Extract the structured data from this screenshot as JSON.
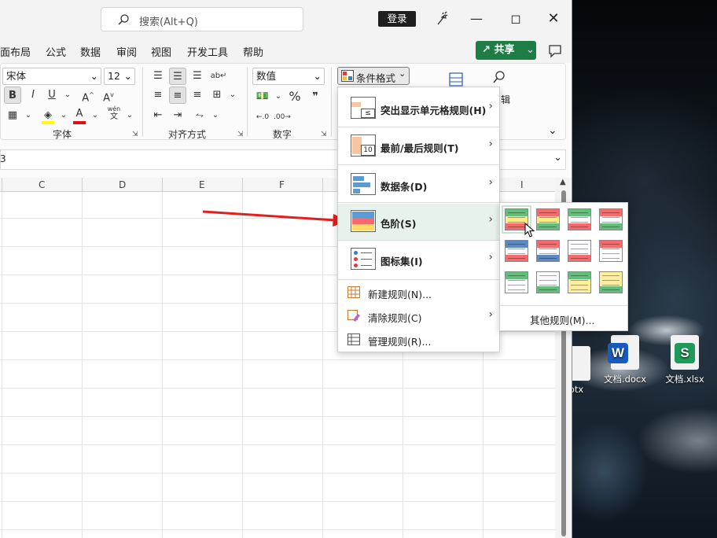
{
  "titlebar": {
    "search_placeholder": "搜索(Alt+Q)",
    "login_label": "登录"
  },
  "menubar": {
    "items": [
      "面布局",
      "公式",
      "数据",
      "审阅",
      "视图",
      "开发工具",
      "帮助"
    ],
    "share_label": "共享"
  },
  "ribbon": {
    "font_name": "宋体",
    "font_size": "12",
    "number_format": "数值",
    "cf_button_label": "条件格式",
    "group_font": "字体",
    "group_align": "对齐方式",
    "group_number": "数字",
    "edit_partial": "辑",
    "bold": "B",
    "italic": "I",
    "underline": "U",
    "font_grow": "A",
    "font_shrink": "A",
    "font_color": "A",
    "percent": "%",
    "comma": "❞",
    "wen": "wén",
    "wen_char": "文"
  },
  "formula": {
    "cell_ref": "3"
  },
  "columns": [
    "C",
    "D",
    "E",
    "F",
    "I"
  ],
  "cf_menu": {
    "items": [
      {
        "label": "突出显示单元格规则(H)",
        "has_sub": true
      },
      {
        "label": "最前/最后规则(T)",
        "has_sub": true
      },
      {
        "label": "数据条(D)",
        "has_sub": true
      },
      {
        "label": "色阶(S)",
        "has_sub": true
      },
      {
        "label": "图标集(I)",
        "has_sub": true
      }
    ],
    "small_items": [
      {
        "label": "新建规则(N)..."
      },
      {
        "label": "清除规则(C)",
        "has_sub": true
      },
      {
        "label": "管理规则(R)..."
      }
    ],
    "icon_10": "10"
  },
  "color_scales": {
    "more_rules": "其他规则(M)...",
    "swatches": [
      [
        "#63be7b",
        "#ffeb84",
        "#f8696b"
      ],
      [
        "#f8696b",
        "#ffeb84",
        "#63be7b"
      ],
      [
        "#63be7b",
        "#fcfcff",
        "#f8696b"
      ],
      [
        "#f8696b",
        "#fcfcff",
        "#63be7b"
      ],
      [
        "#5a8ac6",
        "#fcfcff",
        "#f8696b"
      ],
      [
        "#f8696b",
        "#fcfcff",
        "#5a8ac6"
      ],
      [
        "#fcfcff",
        "#fcfcff",
        "#f8696b"
      ],
      [
        "#f8696b",
        "#fcfcff",
        "#fcfcff"
      ],
      [
        "#63be7b",
        "#fcfcff",
        "#fcfcff"
      ],
      [
        "#fcfcff",
        "#fcfcff",
        "#63be7b"
      ],
      [
        "#63be7b",
        "#ffef9c",
        "#ffef9c"
      ],
      [
        "#ffef9c",
        "#ffef9c",
        "#63be7b"
      ]
    ]
  },
  "desktop": {
    "icons": [
      {
        "label": "otx"
      },
      {
        "label": "文档.docx",
        "badge": "W",
        "color": "#185abd"
      },
      {
        "label": "文档.xlsx",
        "badge": "S",
        "color": "#1e9a59"
      }
    ]
  },
  "accent_colors": {
    "share_green": "#1e7c45",
    "arrow_red": "#e02020",
    "highlight_row": "#e8f2ec"
  }
}
